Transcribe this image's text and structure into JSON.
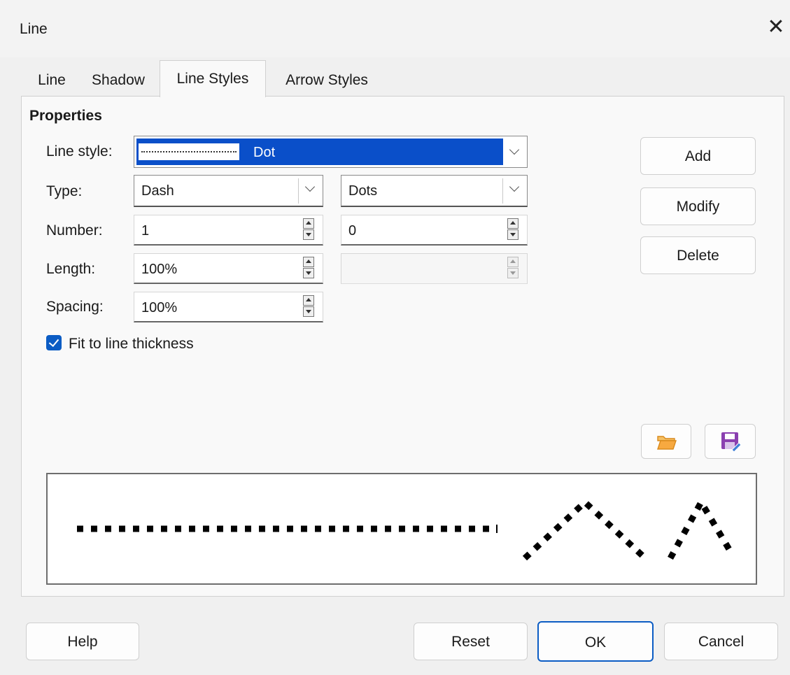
{
  "window": {
    "title": "Line",
    "close_icon": "close-icon"
  },
  "tabs": [
    {
      "label": "Line",
      "active": false
    },
    {
      "label": "Shadow",
      "active": false
    },
    {
      "label": "Line Styles",
      "active": true
    },
    {
      "label": "Arrow Styles",
      "active": false
    }
  ],
  "properties": {
    "heading": "Properties",
    "line_style_label": "Line style:",
    "line_style_value": "Dot",
    "type_label": "Type:",
    "type_value_1": "Dash",
    "type_value_2": "Dots",
    "number_label": "Number:",
    "number_value_1": "1",
    "number_value_2": "0",
    "length_label": "Length:",
    "length_value_1": "100%",
    "length_value_2": "",
    "spacing_label": "Spacing:",
    "spacing_value": "100%",
    "fit_checkbox_label": "Fit to line thickness",
    "fit_checked": true
  },
  "side_buttons": {
    "add": "Add",
    "modify": "Modify",
    "delete": "Delete"
  },
  "file_buttons": {
    "open_icon": "folder-open-icon",
    "save_icon": "floppy-save-icon"
  },
  "colors": {
    "selection": "#0a4fc9",
    "checkbox": "#0b5cc4",
    "folder": "#f2a23a",
    "floppy": "#8a3fb0"
  },
  "footer": {
    "help": "Help",
    "reset": "Reset",
    "ok": "OK",
    "cancel": "Cancel"
  }
}
